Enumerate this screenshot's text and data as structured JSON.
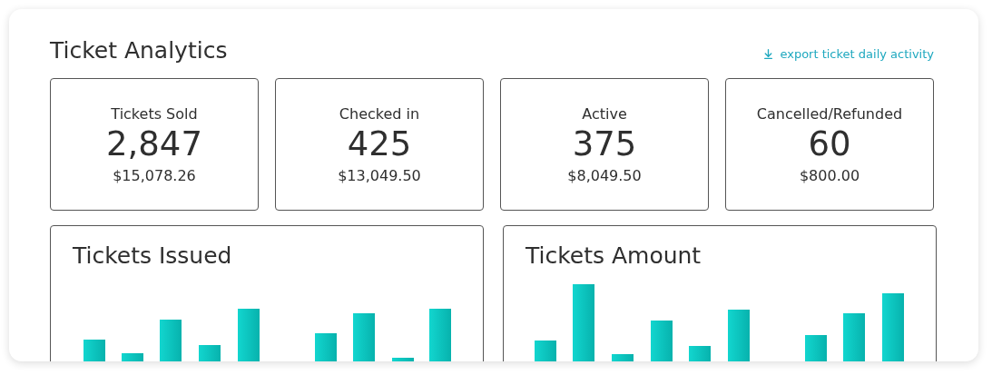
{
  "title": "Ticket Analytics",
  "export_link": {
    "label": "export ticket daily activity"
  },
  "stats": [
    {
      "label": "Tickets Sold",
      "value": "2,847",
      "amount": "$15,078.26"
    },
    {
      "label": "Checked in",
      "value": "425",
      "amount": "$13,049.50"
    },
    {
      "label": "Active",
      "value": "375",
      "amount": "$8,049.50"
    },
    {
      "label": "Cancelled/Refunded",
      "value": "60",
      "amount": "$800.00"
    }
  ],
  "charts": [
    {
      "title": "Tickets Issued"
    },
    {
      "title": "Tickets Amount"
    }
  ]
}
